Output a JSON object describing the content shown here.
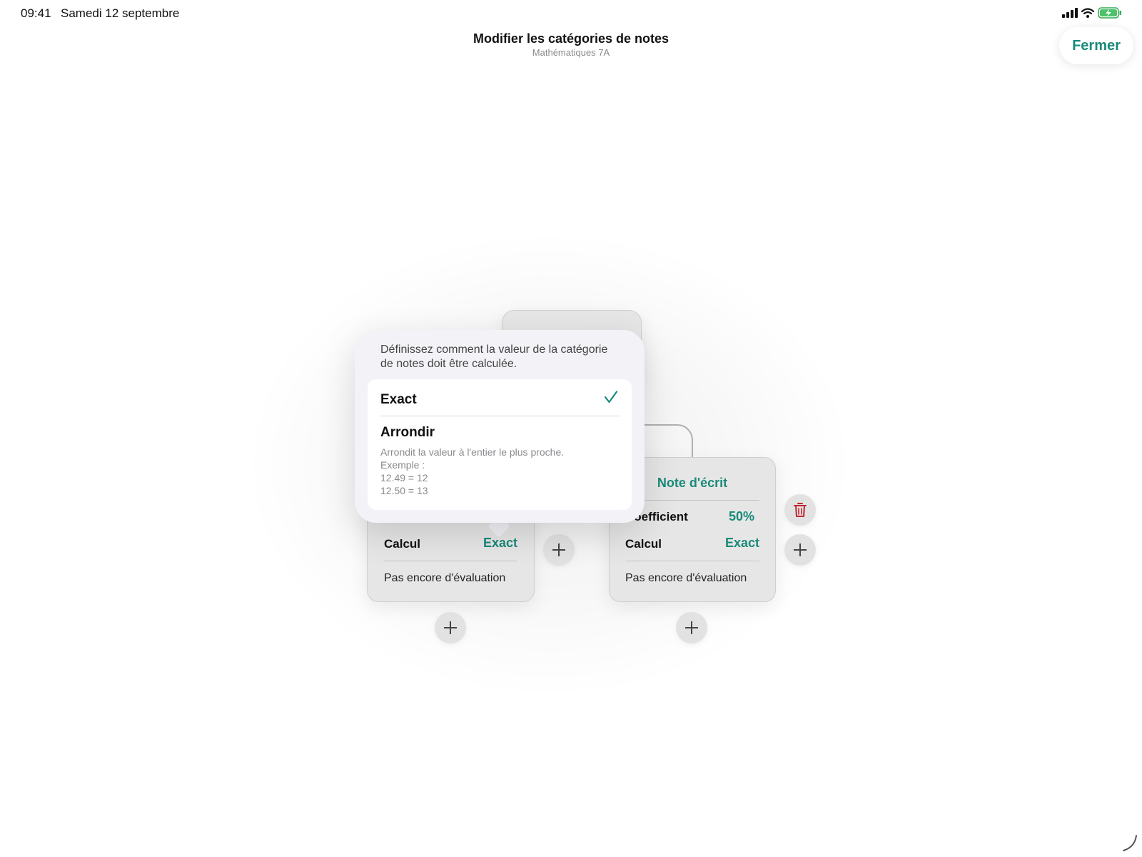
{
  "status_bar": {
    "time": "09:41",
    "date": "Samedi 12 septembre",
    "icons": [
      "signal-icon",
      "wifi-icon",
      "battery-charging-icon"
    ]
  },
  "header": {
    "title": "Modifier les catégories de notes",
    "subtitle": "Mathématiques 7A",
    "close_label": "Fermer"
  },
  "popover": {
    "description": "Définissez comment la valeur de la catégorie de notes doit être calculée.",
    "options": [
      {
        "label": "Exact",
        "selected": true
      },
      {
        "label": "Arrondir",
        "selected": false,
        "description_lines": [
          "Arrondit la valeur à l'entier le plus proche.",
          "Exemple :",
          "12.49 = 12",
          "12.50 = 13"
        ]
      }
    ]
  },
  "cards": {
    "left": {
      "calc_label": "Calcul",
      "calc_value": "Exact",
      "footer": "Pas encore d'évaluation"
    },
    "right": {
      "title": "Note d'écrit",
      "weight_label": "Coefficient",
      "weight_value": "50%",
      "calc_label": "Calcul",
      "calc_value": "Exact",
      "footer": "Pas encore d'évaluation"
    }
  },
  "colors": {
    "accent": "#1a8a7a",
    "delete": "#c0282f",
    "background": "#ffffff",
    "card": "#e6e6e6"
  }
}
